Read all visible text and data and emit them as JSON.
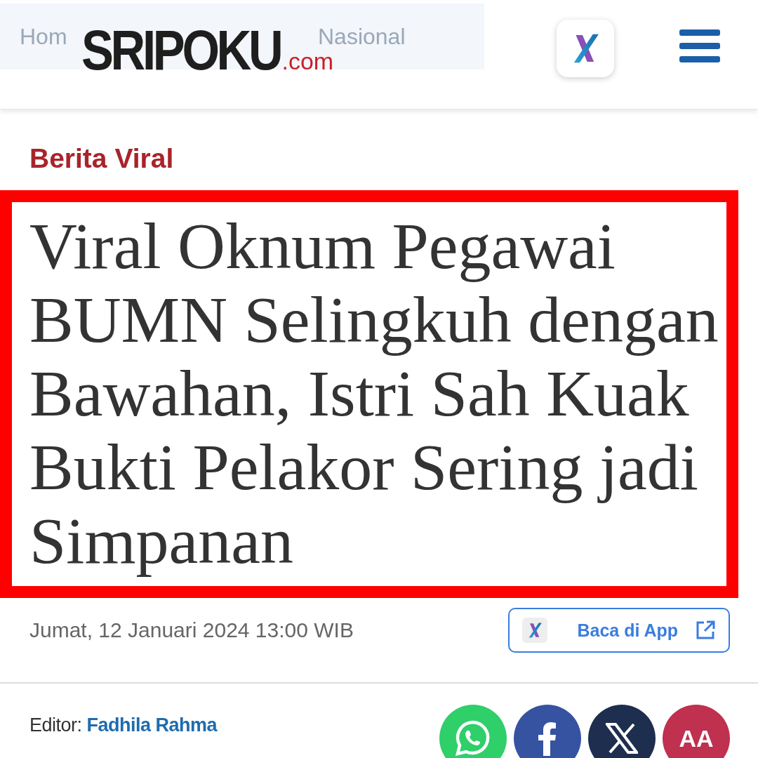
{
  "breadcrumbs": [
    "Hom",
    "Nasional"
  ],
  "header": {
    "logo": {
      "name": "SRIPOKU",
      "suffix": ".com"
    }
  },
  "category": "Berita Viral",
  "headline": "Viral Oknum Pegawai BUMN Selingkuh dengan Bawahan, Istri Sah Kuak Bukti Pelakor Sering jadi Simpanan",
  "date": "Jumat, 12 Januari 2024 13:00 WIB",
  "app_button": {
    "label": "Baca di App"
  },
  "editor": {
    "label": "Editor:",
    "name": "Fadhila Rahma"
  },
  "share_buttons": [
    {
      "kind": "whatsapp",
      "color": "#2fcf6a"
    },
    {
      "kind": "facebook",
      "color": "#3553a1"
    },
    {
      "kind": "x",
      "color": "#1e2e4e"
    },
    {
      "kind": "font",
      "color": "#c0304f",
      "label": "AA"
    }
  ]
}
